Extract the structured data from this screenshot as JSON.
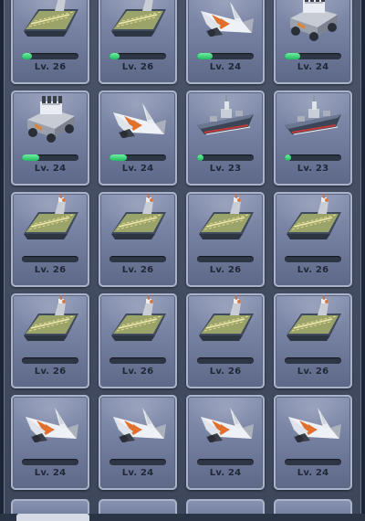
{
  "units": [
    {
      "type": "carrier",
      "level": "Lv. 26",
      "progress": 0.18
    },
    {
      "type": "carrier",
      "level": "Lv. 26",
      "progress": 0.18
    },
    {
      "type": "jet",
      "level": "Lv. 24",
      "progress": 0.28
    },
    {
      "type": "tank",
      "level": "Lv. 24",
      "progress": 0.28
    },
    {
      "type": "tank",
      "level": "Lv. 24",
      "progress": 0.3
    },
    {
      "type": "jet",
      "level": "Lv. 24",
      "progress": 0.3
    },
    {
      "type": "warship",
      "level": "Lv. 23",
      "progress": 0.12
    },
    {
      "type": "warship",
      "level": "Lv. 23",
      "progress": 0.12
    },
    {
      "type": "carrier",
      "level": "Lv. 26",
      "progress": 0
    },
    {
      "type": "carrier",
      "level": "Lv. 26",
      "progress": 0
    },
    {
      "type": "carrier",
      "level": "Lv. 26",
      "progress": 0
    },
    {
      "type": "carrier",
      "level": "Lv. 26",
      "progress": 0
    },
    {
      "type": "carrier",
      "level": "Lv. 26",
      "progress": 0
    },
    {
      "type": "carrier",
      "level": "Lv. 26",
      "progress": 0
    },
    {
      "type": "carrier",
      "level": "Lv. 26",
      "progress": 0
    },
    {
      "type": "carrier",
      "level": "Lv. 26",
      "progress": 0
    },
    {
      "type": "jet",
      "level": "Lv. 24",
      "progress": 0
    },
    {
      "type": "jet",
      "level": "Lv. 24",
      "progress": 0
    },
    {
      "type": "jet",
      "level": "Lv. 24",
      "progress": 0
    },
    {
      "type": "jet",
      "level": "Lv. 24",
      "progress": 0
    }
  ],
  "colors": {
    "progress_fill": "#2fd070",
    "card_bg": "#7f8aaa",
    "level_text": "#1f2636"
  }
}
